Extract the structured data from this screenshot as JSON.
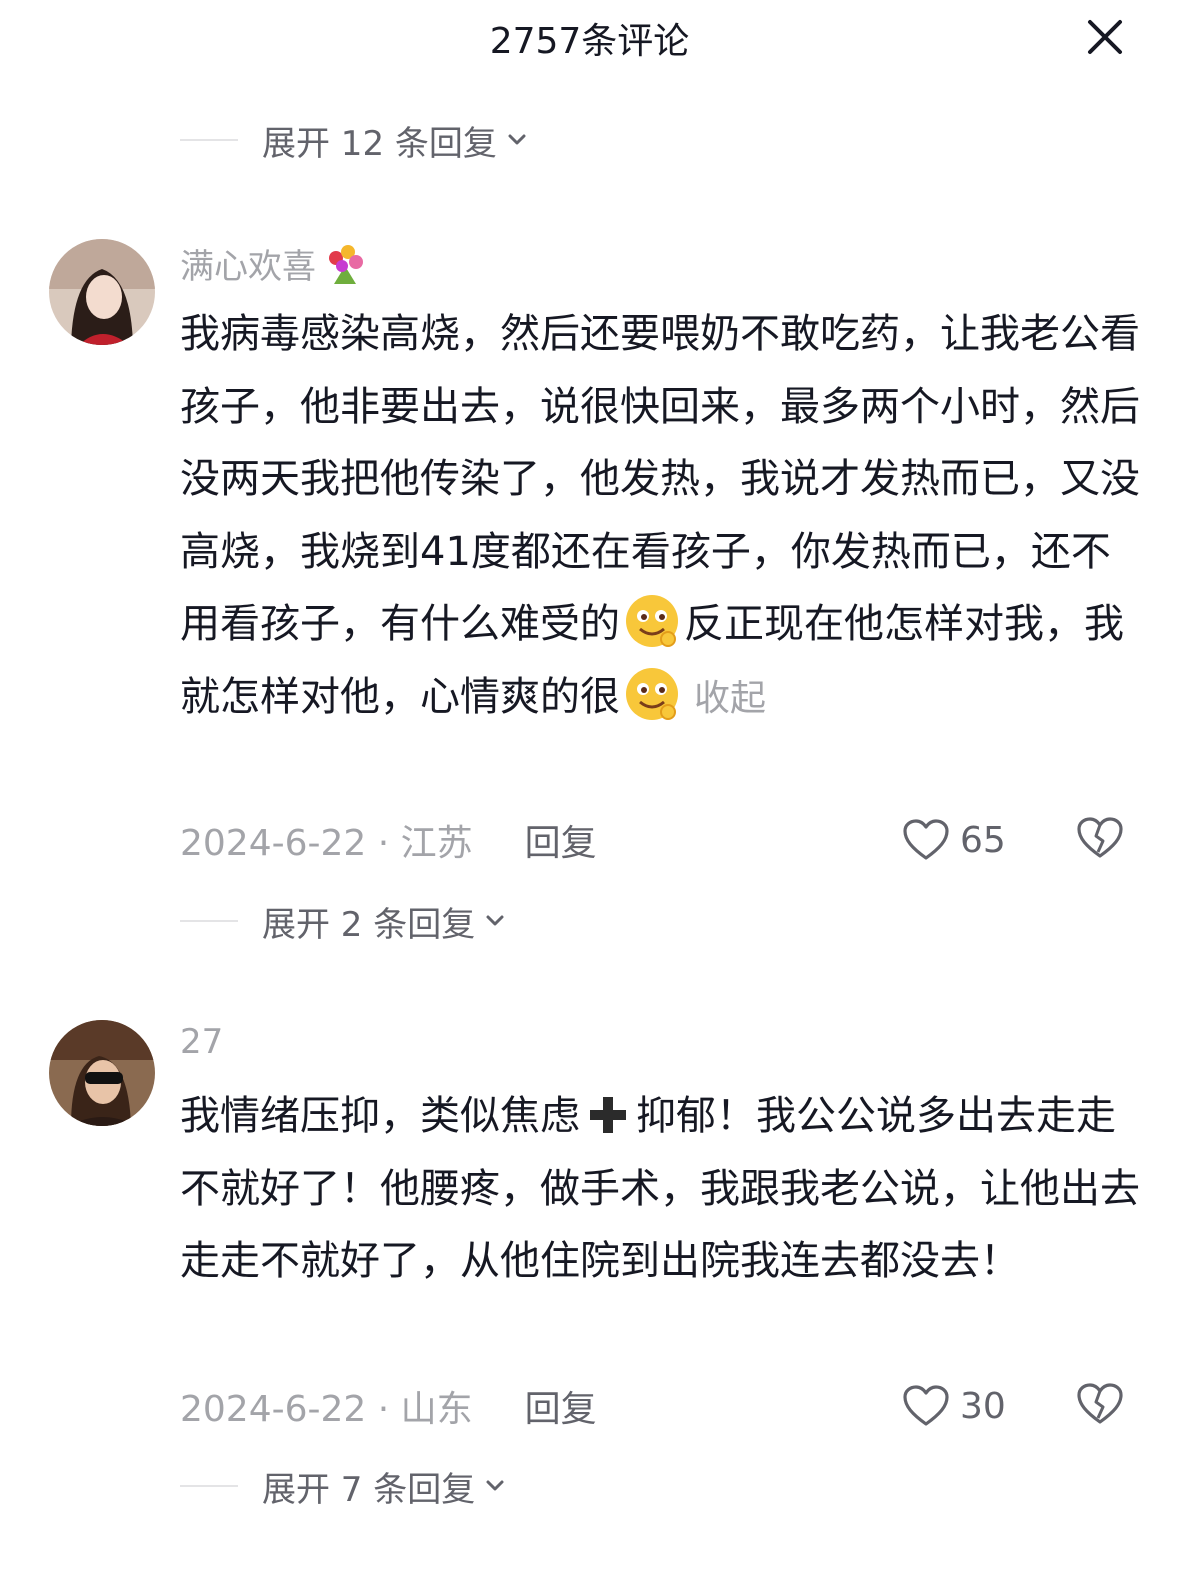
{
  "header": {
    "title": "2757条评论",
    "close_icon": "close-icon"
  },
  "expand_top": {
    "label": "展开 12 条回复"
  },
  "comments": [
    {
      "username": "满心欢喜",
      "username_icon": "bouquet-icon",
      "text_part1": "我病毒感染高烧，然后还要喂奶不敢吃药，让我老公看孩子，他非要出去，说很快回来，最多两个小时，然后没两天我把他传染了，他发热，我说才发热而已，又没高烧，我烧到41度都还在看孩子，你发热而已，还不用看孩子，有什么难受的",
      "text_part2": "反正现在他怎样对我，我就怎样对他，心情爽的很",
      "collapse": "收起",
      "date": "2024-6-22 · 江苏",
      "reply": "回复",
      "likes": "65",
      "expand": "展开 2 条回复"
    },
    {
      "username": "27",
      "text_part1": "我情绪压抑，类似焦虑",
      "text_part2": "抑郁！我公公说多出去走走不就好了！他腰疼，做手术，我跟我老公说，让他出去走走不就好了，从他住院到出院我连去都没去！",
      "date": "2024-6-22 · 山东",
      "reply": "回复",
      "likes": "30",
      "expand": "展开 7 条回复"
    }
  ],
  "colors": {
    "text_primary": "#161823",
    "text_secondary": "#62636b",
    "text_muted": "#a3a4a9",
    "divider": "#e4e4e6"
  }
}
